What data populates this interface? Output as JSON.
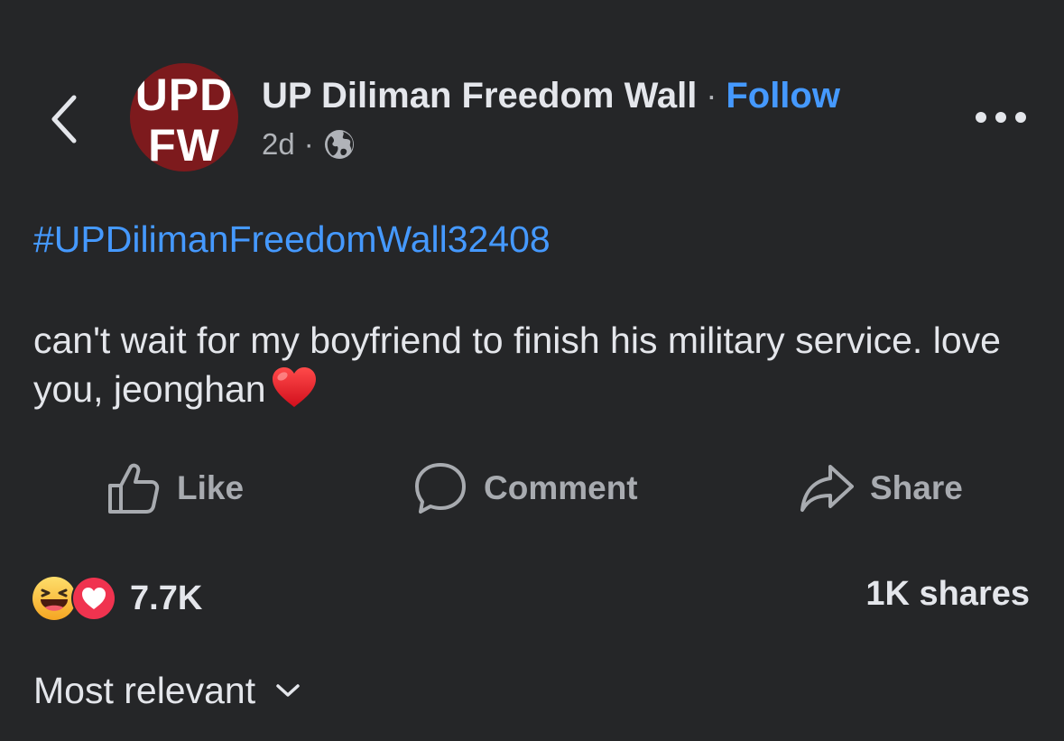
{
  "header": {
    "page_name": "UP Diliman Freedom Wall",
    "separator": "·",
    "follow_label": "Follow",
    "avatar_line1": "UPD",
    "avatar_line2": "FW",
    "timestamp": "2d",
    "meta_separator": "·",
    "privacy_icon": "globe-icon",
    "back_icon": "chevron-left-icon",
    "more_icon": "more-horizontal-icon"
  },
  "post": {
    "hashtag": "#UPDilimanFreedomWall32408",
    "text": "can't wait for my boyfriend to finish his military service. love you, jeonghan",
    "text_emoji": "red-heart-emoji"
  },
  "actions": {
    "like_label": "Like",
    "comment_label": "Comment",
    "share_label": "Share"
  },
  "engagement": {
    "reaction_icons": [
      "haha-reaction-icon",
      "love-reaction-icon"
    ],
    "reaction_count": "7.7K",
    "shares_label": "1K shares"
  },
  "comments": {
    "sort_label": "Most relevant"
  },
  "colors": {
    "background": "#252628",
    "primary_text": "#e4e6eb",
    "secondary_text": "#b0b3b8",
    "link_blue": "#4599ff",
    "avatar_red": "#7d1a1d"
  }
}
